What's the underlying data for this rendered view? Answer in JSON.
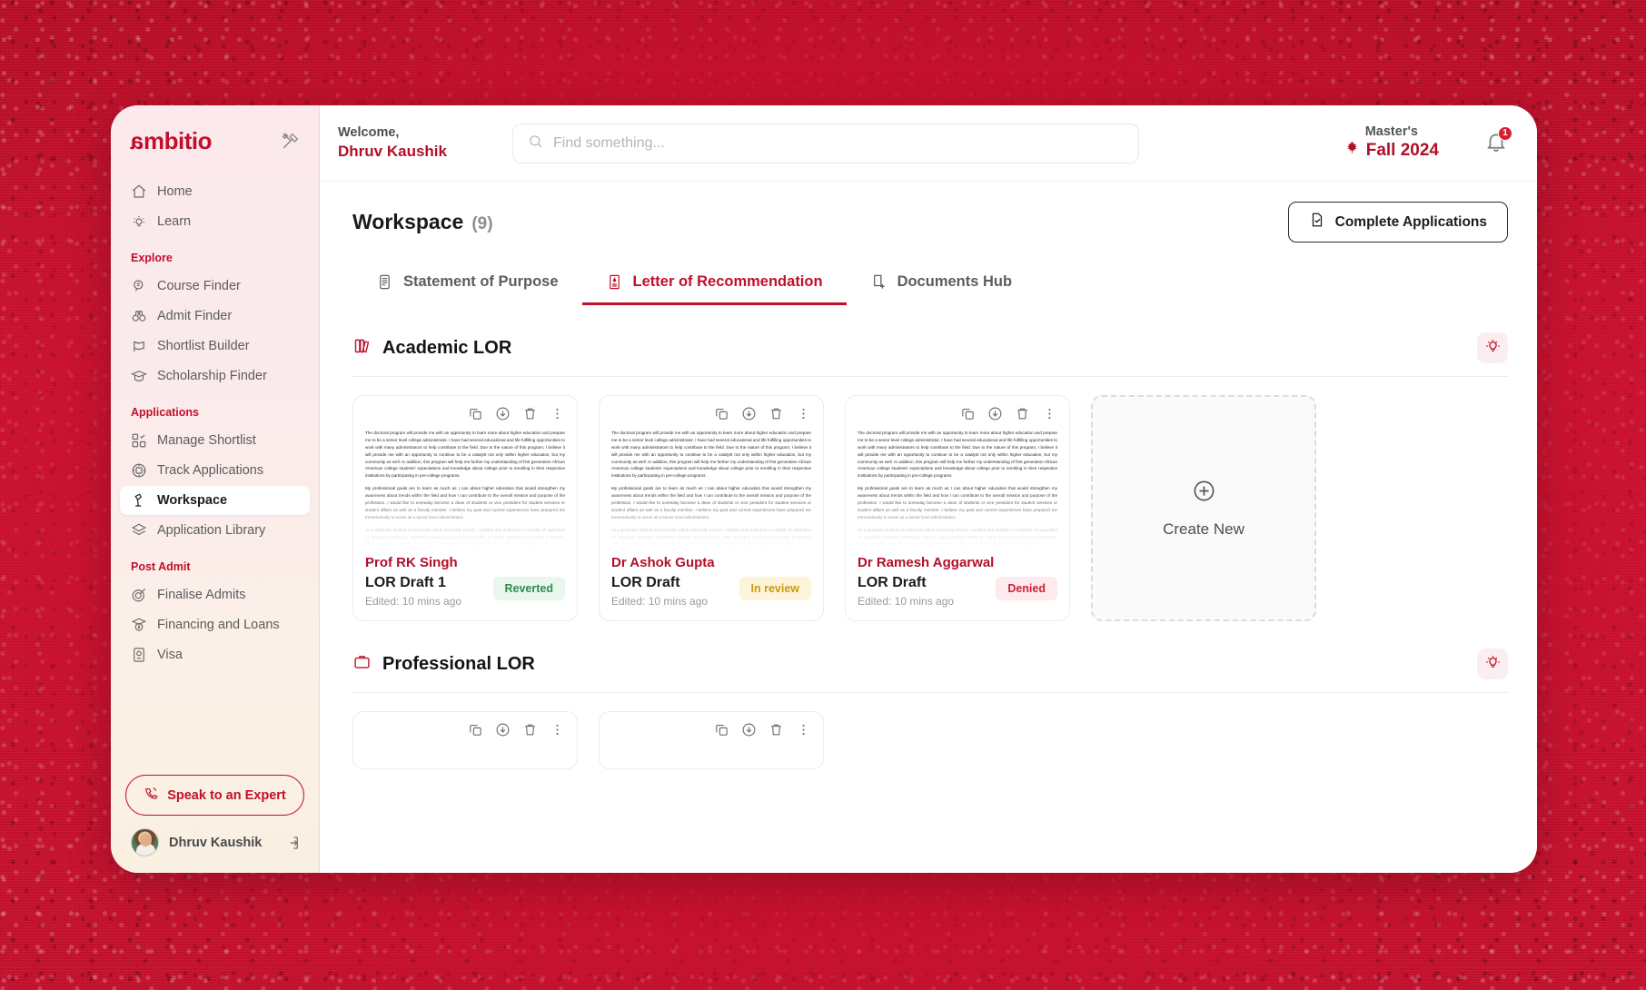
{
  "brand": {
    "name": "ambitio",
    "tool_icon": "wrench-screwdriver-icon"
  },
  "sidebar": {
    "top_items": [
      {
        "label": "Home",
        "icon": "home-icon"
      },
      {
        "label": "Learn",
        "icon": "lightbulb-icon"
      }
    ],
    "groups": [
      {
        "label": "Explore",
        "items": [
          {
            "label": "Course Finder",
            "icon": "magnifier-book-icon"
          },
          {
            "label": "Admit Finder",
            "icon": "binoculars-icon"
          },
          {
            "label": "Shortlist Builder",
            "icon": "flags-icon"
          },
          {
            "label": "Scholarship Finder",
            "icon": "graduation-cap-icon"
          }
        ]
      },
      {
        "label": "Applications",
        "items": [
          {
            "label": "Manage Shortlist",
            "icon": "grid-check-icon"
          },
          {
            "label": "Track Applications",
            "icon": "target-doc-icon"
          },
          {
            "label": "Workspace",
            "icon": "desk-lamp-icon",
            "active": true
          },
          {
            "label": "Application Library",
            "icon": "layers-icon"
          }
        ]
      },
      {
        "label": "Post Admit",
        "items": [
          {
            "label": "Finalise Admits",
            "icon": "target-arrow-icon"
          },
          {
            "label": "Financing and Loans",
            "icon": "money-cap-icon"
          },
          {
            "label": "Visa",
            "icon": "passport-icon"
          }
        ]
      }
    ],
    "expert_button": {
      "label": "Speak to an Expert",
      "icon": "phone-icon"
    },
    "profile": {
      "name": "Dhruv Kaushik",
      "avatar": "user-avatar",
      "logout_icon": "logout-icon"
    }
  },
  "topbar": {
    "welcome_label": "Welcome,",
    "welcome_name": "Dhruv Kaushik",
    "search": {
      "placeholder": "Find something...",
      "value": "",
      "icon": "search-icon"
    },
    "term": {
      "degree": "Master's",
      "session": "Fall 2024",
      "icon": "maple-leaf-icon"
    },
    "notifications": {
      "icon": "bell-icon",
      "count": "1"
    }
  },
  "page": {
    "title": "Workspace",
    "count": "(9)",
    "complete_button": {
      "label": "Complete Applications",
      "icon": "document-check-icon"
    }
  },
  "tabs": [
    {
      "label": "Statement of Purpose",
      "icon": "scroll-doc-icon",
      "active": false
    },
    {
      "label": "Letter of Recommendation",
      "icon": "certificate-icon",
      "active": true
    },
    {
      "label": "Documents Hub",
      "icon": "document-plus-icon",
      "active": false
    }
  ],
  "card_tools": [
    {
      "name": "copy-icon",
      "label": "Copy"
    },
    {
      "name": "download-icon",
      "label": "Download"
    },
    {
      "name": "delete-icon",
      "label": "Delete"
    },
    {
      "name": "more-options-icon",
      "label": "More"
    }
  ],
  "preview_text": {
    "p1": "The doctoral program will provide me with an opportunity to learn more about higher education and prepare me to be a senior level college administrator. I have had several educational and life fulfilling opportunities to work with many administrators to help contribute to the field. Due to the nature of this program; I believe it will provide me with an opportunity to continue to be a catalyst not only within higher education, but my community as well. In addition, this program will help me further my understanding of first generation African American college students' expectations and knowledge about college prior to enrolling in their respective institutions by participating in pre-college programs.",
    "p2": "My professional goals are to learn as much as I can about higher education that would strengthen my awareness about trends within the field and how I can contribute to the overall mission and purpose of the profession. I would like to someday become a dean of students or vice president for student services or student affairs as well as a faculty member. I believe my past and current experiences have prepared me tremendously to serve as a senior level administrator.",
    "p3": "As a graduate student at American online university (AOU), I studied and worked in a number of capacities i.e. graduate assistant, orientation advisor, and practicum within an urban environment located in Denver, CO. I pursued numerous interests and became very strong personal and professional relationships."
  },
  "sections": [
    {
      "title": "Academic LOR",
      "icon": "books-icon",
      "idea_icon": "lightbulb-icon",
      "cards": [
        {
          "author": "Prof RK Singh",
          "draft": "LOR Draft 1",
          "edited": "Edited: 10 mins ago",
          "status": "Reverted",
          "status_kind": "reverted"
        },
        {
          "author": "Dr Ashok Gupta",
          "draft": "LOR Draft",
          "edited": "Edited: 10 mins ago",
          "status": "In review",
          "status_kind": "inreview"
        },
        {
          "author": "Dr Ramesh Aggarwal",
          "draft": "LOR Draft",
          "edited": "Edited: 10 mins ago",
          "status": "Denied",
          "status_kind": "denied"
        }
      ],
      "create": {
        "label": "Create New",
        "icon": "plus-circle-icon"
      }
    },
    {
      "title": "Professional LOR",
      "icon": "briefcase-icon",
      "idea_icon": "lightbulb-icon",
      "cards": [
        {
          "author": "",
          "draft": "",
          "edited": "",
          "status": "",
          "status_kind": ""
        },
        {
          "author": "",
          "draft": "",
          "edited": "",
          "status": "",
          "status_kind": ""
        }
      ]
    }
  ],
  "colors": {
    "brand_red": "#c0102b",
    "accent_red": "#b01028",
    "frame_red": "#c8102e",
    "status_reverted": "#2e8b50",
    "status_inreview": "#c99a12",
    "status_denied": "#cf2038"
  }
}
